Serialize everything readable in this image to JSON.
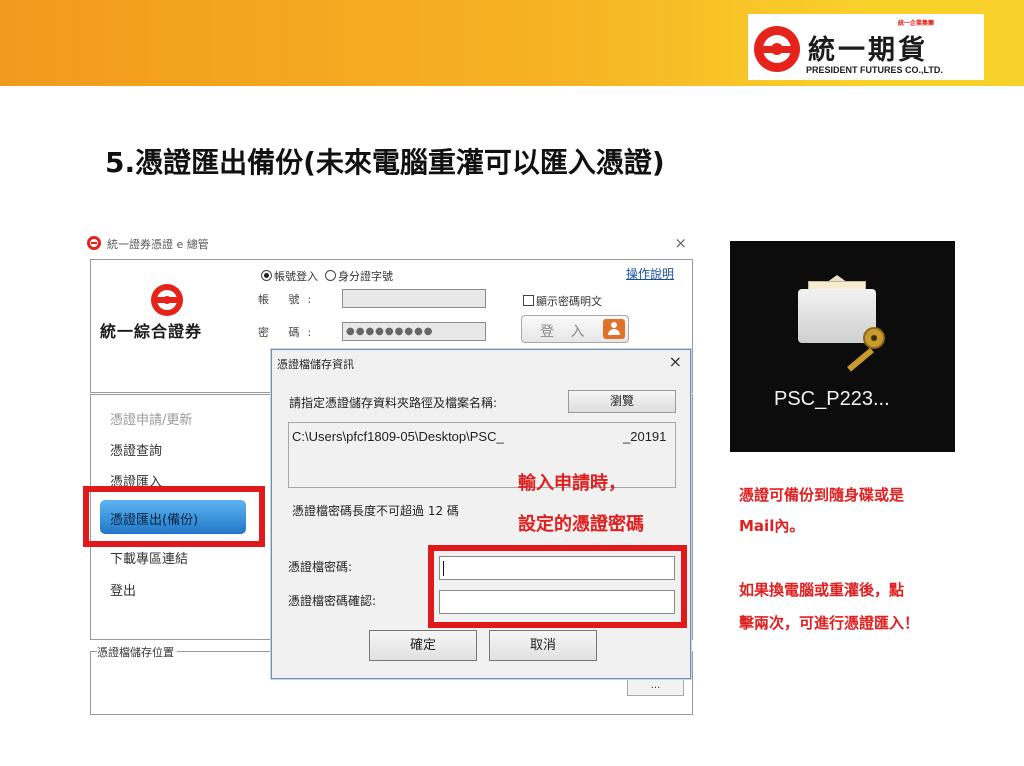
{
  "brand": {
    "name_cn": "統一期貨",
    "name_en": "PRESIDENT FUTURES CO.,LTD.",
    "mini_tag": "統一企業集團",
    "colors": {
      "red": "#e5231b",
      "orange": "#f29a1e",
      "yellow": "#f9d12b"
    }
  },
  "slide": {
    "title": "5.憑證匯出備份(未來電腦重灌可以匯入憑證)"
  },
  "app": {
    "window_title": "統一證券憑證 e 總管",
    "close_symbol": "×",
    "logo_text": "統一綜合證券",
    "login_mode": {
      "option1": "帳號登入",
      "option2": "身分證字號",
      "selected": "帳號登入"
    },
    "help_link": "操作說明",
    "account_label": "帳  號:",
    "password_label": "密  碼:",
    "password_mask": "●●●●●●●●●",
    "show_password_label": "顯示密碼明文",
    "login_button": "登 入",
    "menu": [
      {
        "label": "憑證申請/更新",
        "enabled": false
      },
      {
        "label": "憑證查詢",
        "enabled": true
      },
      {
        "label": "憑證匯入",
        "enabled": true
      },
      {
        "label": "憑證匯出(備份)",
        "enabled": true,
        "active": true
      },
      {
        "label": "下載專區連結",
        "enabled": true
      },
      {
        "label": "登出",
        "enabled": true
      }
    ],
    "storage_label": "憑證檔儲存位置",
    "ellipsis_button": "..."
  },
  "dialog": {
    "title": "憑證檔儲存資訊",
    "close_symbol": "×",
    "prompt": "請指定憑證儲存資料夾路徑及檔案名稱:",
    "browse_button": "瀏覽",
    "path_part1": "C:\\Users\\pfcf1809-05\\Desktop\\PSC_",
    "path_part2": "_20191",
    "length_note": "憑證檔密碼長度不可超過 12 碼",
    "password_label": "憑證檔密碼:",
    "confirm_label": "憑證檔密碼確認:",
    "ok_button": "確定",
    "cancel_button": "取消"
  },
  "annotations": {
    "dialog_note_line1": "輸入申請時，",
    "dialog_note_line2": "設定的憑證密碼",
    "side_lines": [
      "憑證可備份到隨身碟或是",
      "Mail內。",
      "如果換電腦或重灌後，點",
      "擊兩次，可進行憑證匯入！"
    ],
    "highlight_color": "#e01a1a"
  },
  "file_icon": {
    "label": "PSC_P223...",
    "icon": "certificate-envelope-key-icon"
  }
}
